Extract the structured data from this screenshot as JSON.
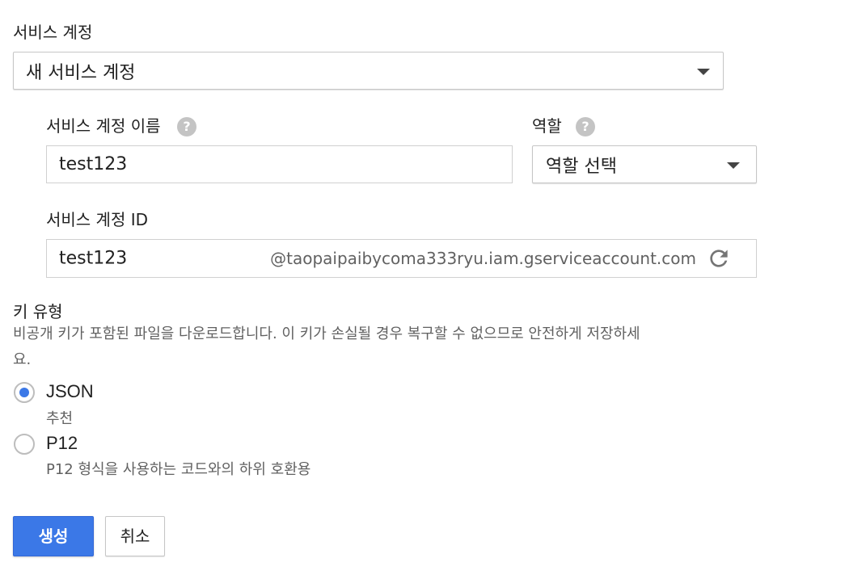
{
  "service_account": {
    "label": "서비스 계정",
    "selected": "새 서비스 계정"
  },
  "account_name": {
    "label": "서비스 계정 이름",
    "help": "?",
    "value": "test123"
  },
  "role": {
    "label": "역할",
    "help": "?",
    "selected": "역할 선택"
  },
  "account_id": {
    "label": "서비스 계정 ID",
    "value": "test123",
    "domain": "@taopaipaibycoma333ryu.iam.gserviceaccount.com"
  },
  "key_type": {
    "label": "키 유형",
    "description_line1": "비공개 키가 포함된 파일을 다운로드합니다. 이 키가 손실될 경우 복구할 수 없으므로 안전하게 저장하세",
    "description_line2": "요.",
    "options": [
      {
        "label": "JSON",
        "sub": "추천",
        "checked": true
      },
      {
        "label": "P12",
        "sub": "P12 형식을 사용하는 코드와의 하위 호환용",
        "checked": false
      }
    ]
  },
  "actions": {
    "create_label": "생성",
    "cancel_label": "취소"
  },
  "colors": {
    "primary": "#3b78e7",
    "radio_checked": "#3b78e7"
  }
}
